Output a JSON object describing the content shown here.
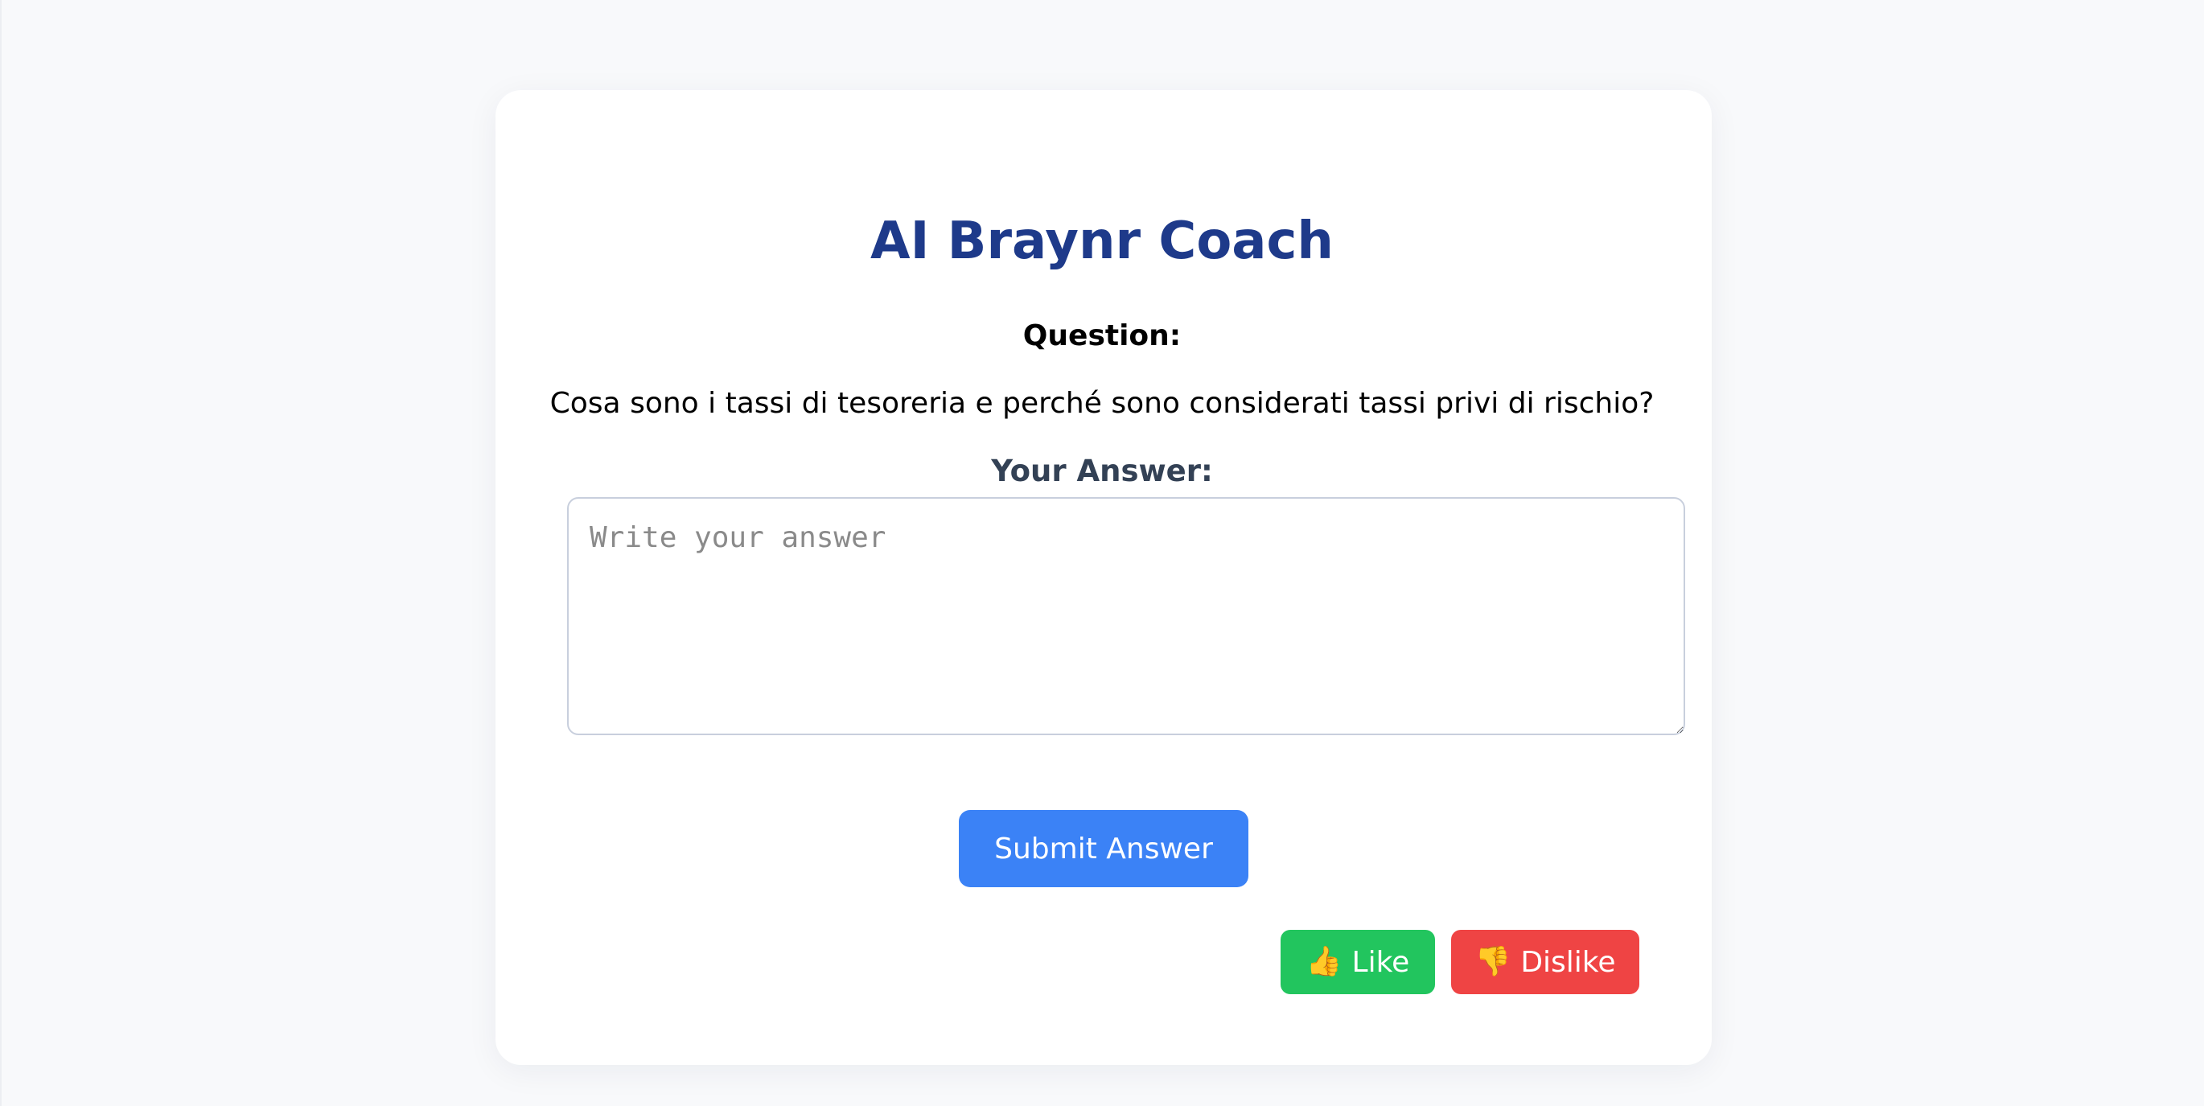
{
  "app": {
    "title": "AI Braynr Coach"
  },
  "question": {
    "label": "Question:",
    "text": "Cosa sono i tassi di tesoreria e perché sono considerati tassi privi di rischio?"
  },
  "answer": {
    "label": "Your Answer:",
    "placeholder": "Write your answer",
    "value": ""
  },
  "actions": {
    "submit_label": "Submit Answer",
    "like": {
      "icon": "thumbs-up-icon",
      "glyph": "👍",
      "label": "Like"
    },
    "dislike": {
      "icon": "thumbs-down-icon",
      "glyph": "👎",
      "label": "Dislike"
    }
  },
  "colors": {
    "title": "#1e3a8a",
    "submit": "#3b82f6",
    "like": "#22c55e",
    "dislike": "#ef4444",
    "background": "#f8f9fb"
  }
}
